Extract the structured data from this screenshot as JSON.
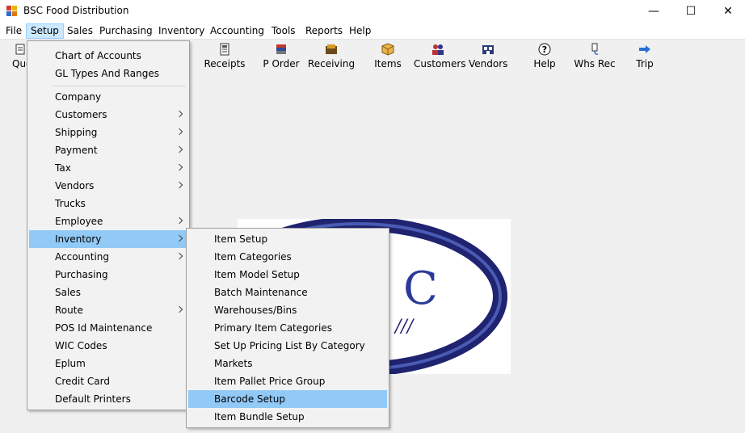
{
  "window": {
    "title": "BSC Food Distribution",
    "minimize_glyph": "—",
    "maximize_glyph": "☐",
    "close_glyph": "✕"
  },
  "menubar": {
    "items": [
      "File",
      "Setup",
      "Sales",
      "Purchasing",
      "Inventory",
      "Accounting",
      "Tools",
      "Reports",
      "Help"
    ],
    "open_item": "Setup"
  },
  "toolbar": {
    "first_partial_label": "Quo",
    "items": [
      {
        "label": "Receipts",
        "icon": "receipt-icon"
      },
      {
        "label": "P Order",
        "icon": "purchase-order-icon"
      },
      {
        "label": "Receiving",
        "icon": "receiving-icon"
      },
      {
        "label": "Items",
        "icon": "box-icon"
      },
      {
        "label": "Customers",
        "icon": "customers-icon"
      },
      {
        "label": "Vendors",
        "icon": "vendors-icon"
      },
      {
        "label": "Help",
        "icon": "help-icon"
      },
      {
        "label": "Whs Rec",
        "icon": "warehouse-receipt-icon"
      },
      {
        "label": "Trip",
        "icon": "arrow-right-icon"
      }
    ]
  },
  "setup_menu": {
    "items": [
      {
        "label": "Chart of Accounts",
        "submenu": false
      },
      {
        "label": "GL Types And Ranges",
        "submenu": false
      },
      {
        "label": "Company",
        "submenu": false
      },
      {
        "label": "Customers",
        "submenu": true
      },
      {
        "label": "Shipping",
        "submenu": true
      },
      {
        "label": "Payment",
        "submenu": true
      },
      {
        "label": "Tax",
        "submenu": true
      },
      {
        "label": "Vendors",
        "submenu": true
      },
      {
        "label": "Trucks",
        "submenu": false
      },
      {
        "label": "Employee",
        "submenu": true
      },
      {
        "label": "Inventory",
        "submenu": true,
        "highlighted": true
      },
      {
        "label": "Accounting",
        "submenu": true
      },
      {
        "label": "Purchasing",
        "submenu": false
      },
      {
        "label": "Sales",
        "submenu": false
      },
      {
        "label": "Route",
        "submenu": true
      },
      {
        "label": "POS Id Maintenance",
        "submenu": false
      },
      {
        "label": "WIC Codes",
        "submenu": false
      },
      {
        "label": "Eplum",
        "submenu": false
      },
      {
        "label": "Credit Card",
        "submenu": false
      },
      {
        "label": "Default Printers",
        "submenu": false
      }
    ]
  },
  "inventory_submenu": {
    "items": [
      {
        "label": "Item Setup"
      },
      {
        "label": "Item Categories"
      },
      {
        "label": "Item Model Setup"
      },
      {
        "label": "Batch Maintenance"
      },
      {
        "label": "Warehouses/Bins"
      },
      {
        "label": "Primary Item Categories"
      },
      {
        "label": "Set Up Pricing List By Category"
      },
      {
        "label": "Markets"
      },
      {
        "label": "Item Pallet Price Group"
      },
      {
        "label": "Barcode Setup",
        "highlighted": true
      },
      {
        "label": "Item Bundle Setup"
      }
    ]
  },
  "logo": {
    "visible_letter": "C"
  },
  "colors": {
    "highlight": "#91c9f7",
    "menubar_open": "#cce8ff",
    "logo_navy": "#1f2370"
  }
}
